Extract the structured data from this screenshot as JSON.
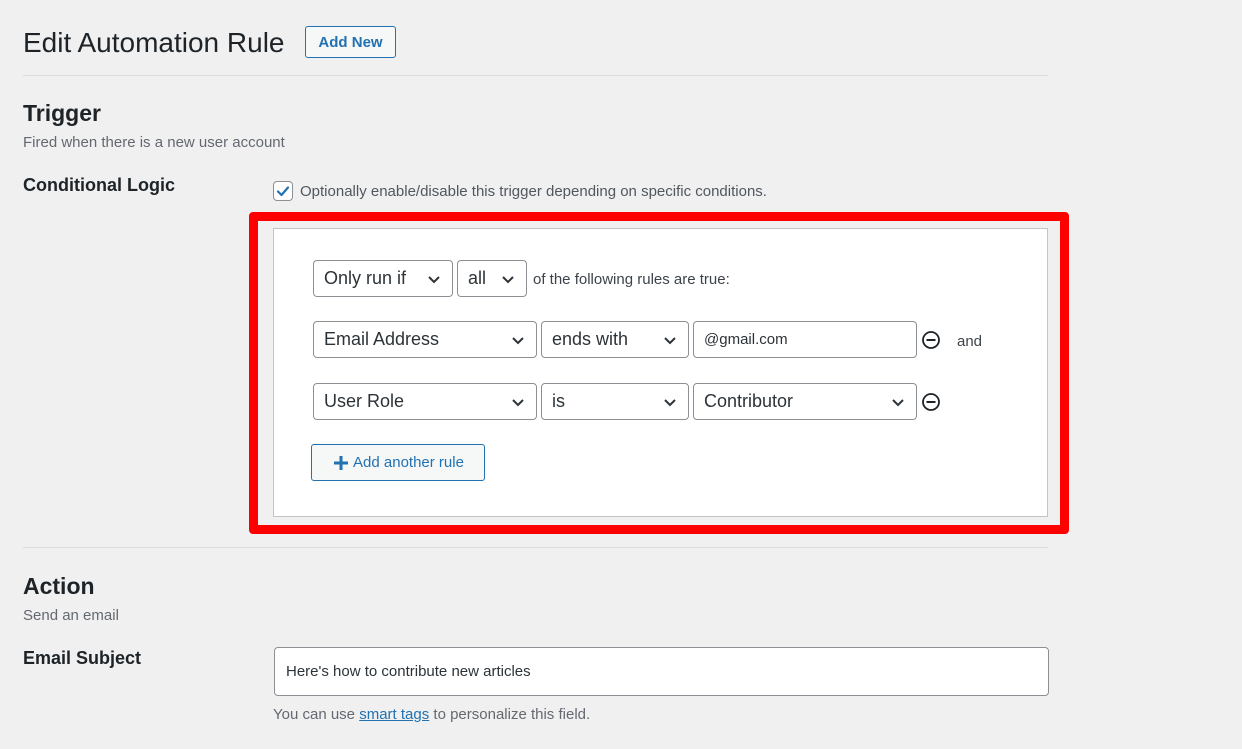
{
  "header": {
    "title": "Edit Automation Rule",
    "add_new_label": "Add New"
  },
  "trigger": {
    "title": "Trigger",
    "description": "Fired when there is a new user account",
    "conditional_logic_label": "Conditional Logic",
    "checkbox_checked": true,
    "checkbox_text": "Optionally enable/disable this trigger depending on specific conditions.",
    "logic": {
      "run_select": "Only run if",
      "match_select": "all",
      "match_suffix": "of the following rules are true:",
      "rules": [
        {
          "field": "Email Address",
          "operator": "ends with",
          "value": "@gmail.com",
          "value_type": "text",
          "connector": "and"
        },
        {
          "field": "User Role",
          "operator": "is",
          "value": "Contributor",
          "value_type": "select",
          "connector": ""
        }
      ],
      "add_rule_label": "Add another rule"
    }
  },
  "action": {
    "title": "Action",
    "description": "Send an email",
    "email_subject_label": "Email Subject",
    "email_subject_value": "Here's how to contribute new articles",
    "help_prefix": "You can use",
    "help_link": "smart tags",
    "help_suffix": "to personalize this field."
  },
  "colors": {
    "accent": "#2271b1",
    "highlight_border": "#ff0000",
    "background": "#f0f0f1"
  },
  "icons": {
    "checkbox": "checkmark-icon",
    "dropdown": "chevron-down-icon",
    "remove": "minus-circle-icon",
    "add": "plus-icon"
  }
}
